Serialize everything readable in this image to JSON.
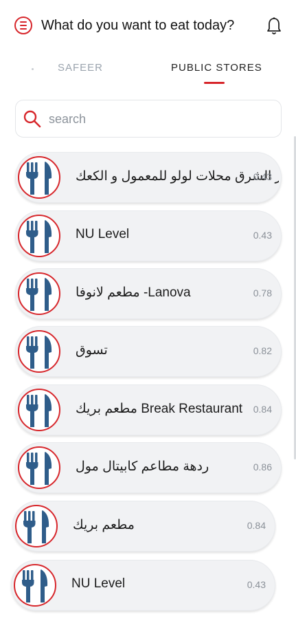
{
  "header": {
    "title": "What do you want to eat today?",
    "menu_icon": "menu-icon",
    "bell_icon": "bell-icon"
  },
  "tabs": [
    {
      "label": "SAFEER",
      "active": false
    },
    {
      "label": "PUBLIC STORES",
      "active": true
    }
  ],
  "search": {
    "placeholder": "search",
    "value": ""
  },
  "colors": {
    "accent": "#d7262b",
    "icon_blue": "#2f5d8a"
  },
  "stores": [
    {
      "name": "مخابز الشرق محلات لولو للمعمول و الكعك",
      "distance": "0.43",
      "icon": "restaurant-icon"
    },
    {
      "name": "NU Level",
      "distance": "0.43",
      "icon": "restaurant-icon"
    },
    {
      "name": "مطعم لانوفا -Lanova",
      "distance": "0.78",
      "icon": "restaurant-icon"
    },
    {
      "name": "تسوق",
      "distance": "0.82",
      "icon": "restaurant-icon"
    },
    {
      "name": "مطعم بريك Break Restaurant",
      "distance": "0.84",
      "icon": "restaurant-icon"
    },
    {
      "name": "ردهة مطاعم كابيتال مول",
      "distance": "0.86",
      "icon": "restaurant-icon"
    },
    {
      "name": "مطعم بريك",
      "distance": "0.84",
      "icon": "restaurant-icon"
    },
    {
      "name": "NU Level",
      "distance": "0.43",
      "icon": "restaurant-icon"
    }
  ]
}
